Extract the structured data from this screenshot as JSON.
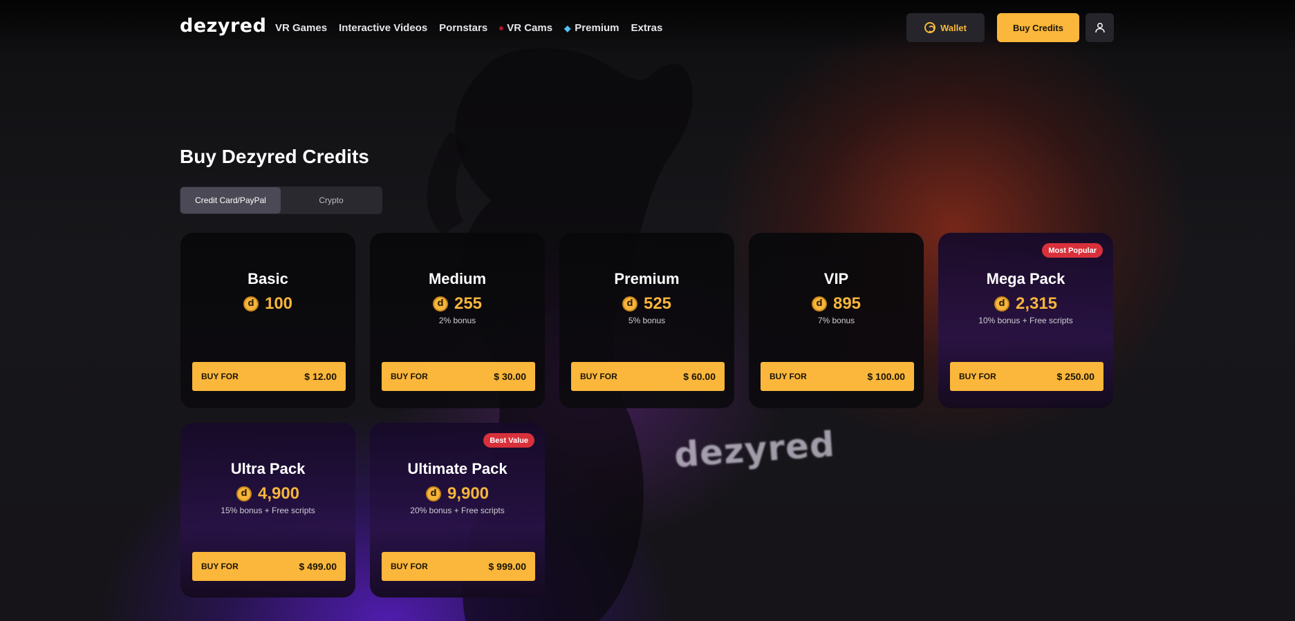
{
  "header": {
    "logo": "dezyred",
    "nav": [
      "VR Games",
      "Interactive Videos",
      "Pornstars",
      "VR Cams",
      "Premium",
      "Extras"
    ],
    "wallet_label": "Wallet",
    "buy_credits_label": "Buy Credits"
  },
  "background": {
    "watermark": "dezyred"
  },
  "main": {
    "title": "Buy Dezyred Credits",
    "tabs": [
      {
        "label": "Credit Card/PayPal",
        "active": true
      },
      {
        "label": "Crypto",
        "active": false
      }
    ],
    "coin_glyph": "d",
    "cards": [
      {
        "name": "Basic",
        "amount": "100",
        "bonus": "",
        "buy_label": "BUY FOR",
        "price": "$ 12.00",
        "badge": ""
      },
      {
        "name": "Medium",
        "amount": "255",
        "bonus": "2% bonus",
        "buy_label": "BUY FOR",
        "price": "$ 30.00",
        "badge": ""
      },
      {
        "name": "Premium",
        "amount": "525",
        "bonus": "5% bonus",
        "buy_label": "BUY FOR",
        "price": "$ 60.00",
        "badge": ""
      },
      {
        "name": "VIP",
        "amount": "895",
        "bonus": "7% bonus",
        "buy_label": "BUY FOR",
        "price": "$ 100.00",
        "badge": ""
      },
      {
        "name": "Mega Pack",
        "amount": "2,315",
        "bonus": "10% bonus + Free scripts",
        "buy_label": "BUY FOR",
        "price": "$ 250.00",
        "badge": "Most Popular"
      },
      {
        "name": "Ultra Pack",
        "amount": "4,900",
        "bonus": "15% bonus + Free scripts",
        "buy_label": "BUY FOR",
        "price": "$ 499.00",
        "badge": ""
      },
      {
        "name": "Ultimate Pack",
        "amount": "9,900",
        "bonus": "20% bonus + Free scripts",
        "buy_label": "BUY FOR",
        "price": "$ 999.00",
        "badge": "Best Value"
      }
    ]
  },
  "colors": {
    "accent": "#fbb73b",
    "badge": "#d9313b",
    "coin": "#f7b53c",
    "live_dot": "#b0102a"
  },
  "icons": [
    "wallet-icon",
    "user-icon",
    "coin-icon",
    "diamond-icon",
    "live-dot-icon"
  ]
}
